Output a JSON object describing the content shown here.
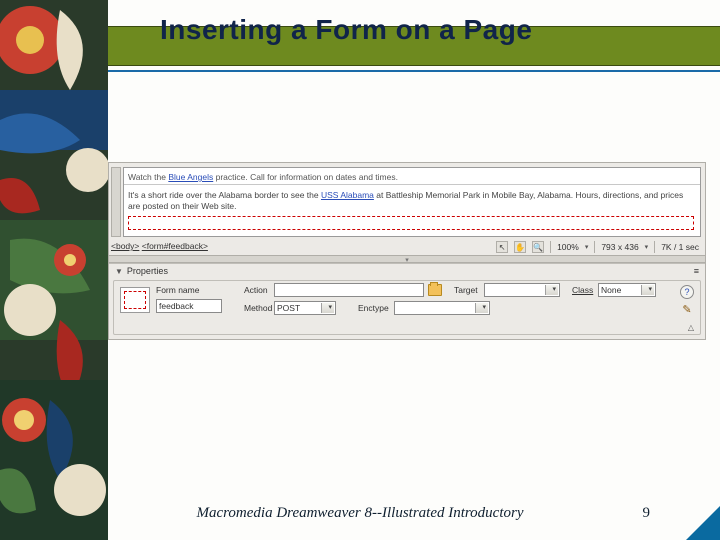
{
  "slide": {
    "title": "Inserting a Form on a Page",
    "footer": "Macromedia Dreamweaver 8--Illustrated Introductory",
    "page_number": "9"
  },
  "doc": {
    "line1_a": "Watch the ",
    "line1_link": "Blue Angels",
    "line1_b": " practice. Call for information on dates and times.",
    "line2_a": "It's a short ride over the Alabama border to see the ",
    "line2_link": "USS Alabama",
    "line2_b": "  at Battleship Memorial Park in Mobile Bay, Alabama. Hours, directions, and prices are posted on their Web site."
  },
  "tags": {
    "body": "<body>",
    "form": "<form#feedback>"
  },
  "status": {
    "zoom": "100%",
    "dims": "793 x 436",
    "size": "7K / 1 sec"
  },
  "properties": {
    "panel_title": "Properties",
    "menu_glyph": "≡",
    "form_name_label": "Form name",
    "form_name_value": "feedback",
    "action_label": "Action",
    "action_value": "",
    "method_label": "Method",
    "method_value": "POST",
    "enctype_label": "Enctype",
    "enctype_value": "",
    "target_label": "Target",
    "target_value": "",
    "class_label": "Class",
    "class_value": "None",
    "help": "?",
    "pencil": "✎"
  }
}
